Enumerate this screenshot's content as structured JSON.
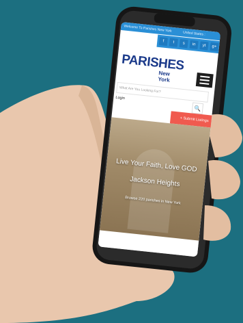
{
  "topbar": {
    "welcome": "Welcome To Parishes New York",
    "country": "United States :"
  },
  "social": [
    "f",
    "t",
    "s",
    "in",
    "yt",
    "g+"
  ],
  "logo": {
    "main": "PARISHES",
    "sub": "New York"
  },
  "search": {
    "placeholder": "What Are You Looking For?"
  },
  "login_label": "Login",
  "submit_label": "+ Submit Listings",
  "hero": {
    "title_line1": "Live Your Faith, Love GOD",
    "title_line2": "Jackson Heights",
    "browse_text": "Browse 220 parishes in New York"
  },
  "colors": {
    "background": "#1c6f80",
    "topbar": "#2a8fd6",
    "accent": "#f05a4f",
    "logo": "#1b3a8a"
  }
}
